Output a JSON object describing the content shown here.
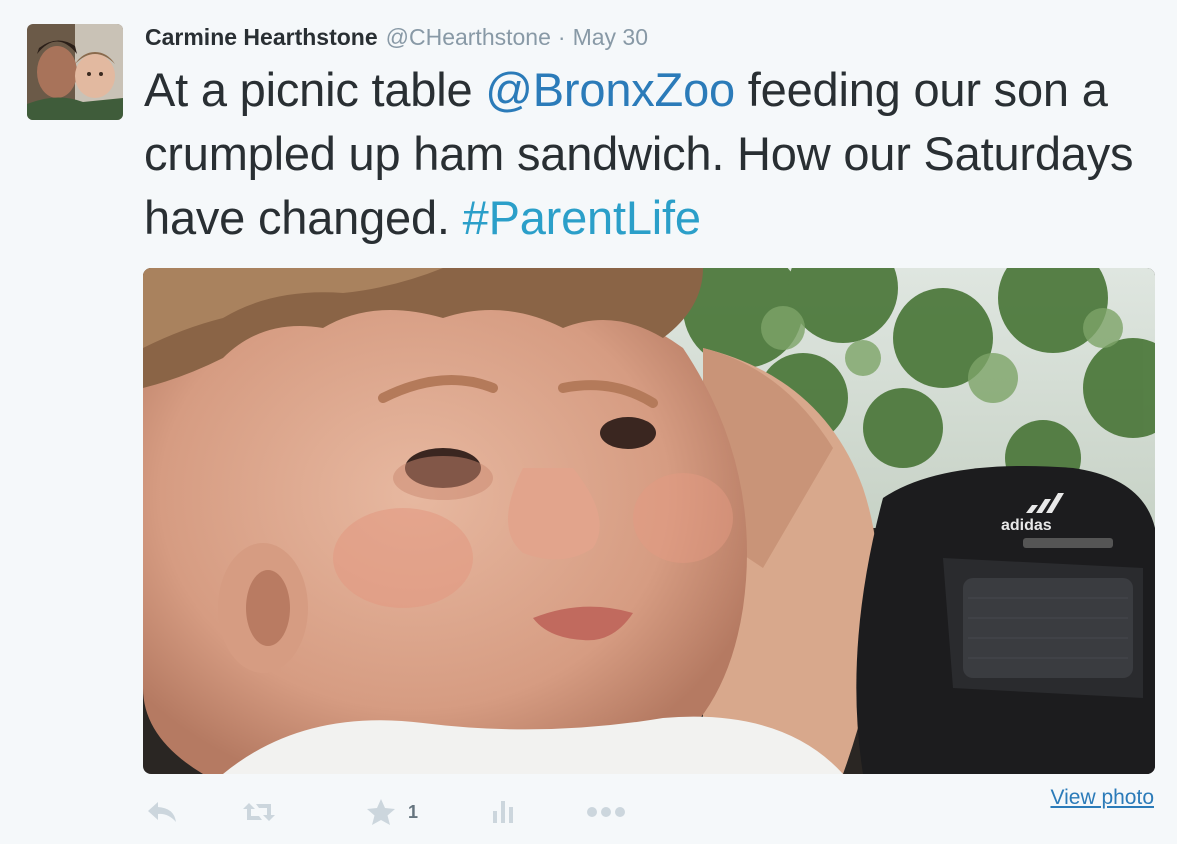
{
  "author": {
    "name": "Carmine Hearthstone",
    "handle": "@CHearthstone",
    "separator": "·",
    "date": "May 30"
  },
  "tweet": {
    "text_1": "At a picnic table ",
    "mention": "@BronxZoo",
    "text_2": " feeding our son a crumpled up ham sandwich. How our Saturdays have changed. ",
    "hashtag": "#ParentLife"
  },
  "photo": {
    "logo_text": "adidas"
  },
  "actions": {
    "reply_icon": "reply-icon",
    "retweet_icon": "retweet-icon",
    "favorite_icon": "star-icon",
    "favorite_count": "1",
    "stats_icon": "bar-chart-icon",
    "more_icon": "more-dots-icon",
    "view_photo": "View photo"
  },
  "colors": {
    "background": "#f5f8fa",
    "text": "#292f33",
    "muted": "#8899a6",
    "link": "#2b7bb9",
    "icon": "#ccd6dd"
  }
}
